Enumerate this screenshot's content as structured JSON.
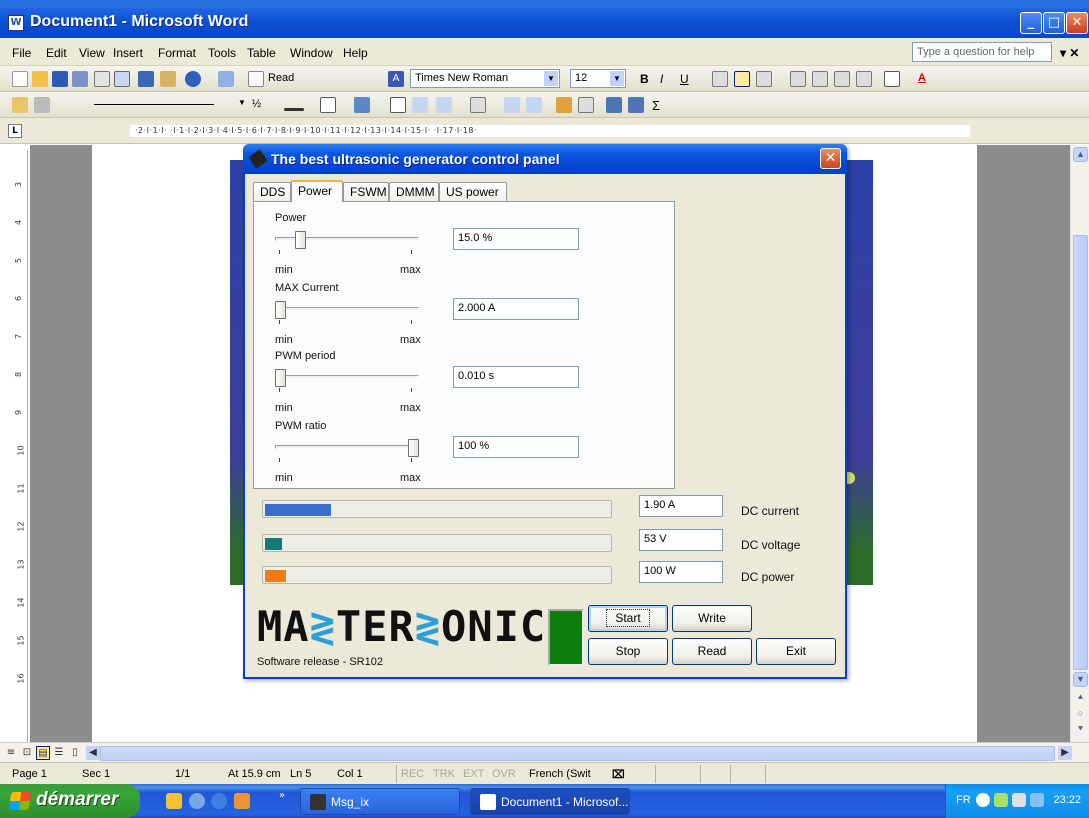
{
  "word": {
    "title": "Document1 - Microsoft Word",
    "menu": [
      "File",
      "Edit",
      "View",
      "Insert",
      "Format",
      "Tools",
      "Table",
      "Window",
      "Help"
    ],
    "help_placeholder": "Type a question for help",
    "read_label": "Read",
    "font_name": "Times New Roman",
    "font_size": "12",
    "line_width": "½",
    "ruler_marks": "·2·I·1·I·  ·I·1·I·2·I·3·I·4·I·5·I·6·I·7·I·8·I·9·I·10·I·11·I·12·I·13·I·14·I·15·I·  ·I·17·I·18·",
    "left_ruler_marks": [
      "3",
      "4",
      "5",
      "6",
      "7",
      "8",
      "9",
      "10",
      "11",
      "12",
      "13",
      "14",
      "15",
      "16"
    ]
  },
  "status": {
    "page": "Page 1",
    "sec": "Sec 1",
    "pages": "1/1",
    "at": "At 15.9 cm",
    "ln": "Ln 5",
    "col": "Col 1",
    "rec": "REC",
    "trk": "TRK",
    "ext": "EXT",
    "ovr": "OVR",
    "lang": "French (Swit"
  },
  "taskbar": {
    "start": "démarrer",
    "tasks": [
      "Msg_ix",
      "Document1 - Microsof..."
    ],
    "lang": "FR",
    "clock": "23:22"
  },
  "dialog": {
    "title": "The best ultrasonic generator control panel",
    "tabs": [
      "DDS",
      "Power",
      "FSWM",
      "DMMM",
      "US power"
    ],
    "active_tab": "Power",
    "sliders": [
      {
        "label": "Power",
        "value": "15.0 %",
        "min": "min",
        "max": "max",
        "level": 0.15
      },
      {
        "label": "MAX Current",
        "value": "2.000 A",
        "min": "min",
        "max": "max",
        "level": 0.0
      },
      {
        "label": "PWM period",
        "value": "0.010 s",
        "min": "min",
        "max": "max",
        "level": 0.0
      },
      {
        "label": "PWM ratio",
        "value": "100 %",
        "min": "min",
        "max": "max",
        "level": 1.0
      }
    ],
    "meters": [
      {
        "label": "DC current",
        "value": "1.90 A",
        "level": 0.19,
        "color": "#3a6fcf"
      },
      {
        "label": "DC voltage",
        "value": "53 V",
        "level": 0.05,
        "color": "#0f7c75"
      },
      {
        "label": "DC power",
        "value": "100 W",
        "level": 0.06,
        "color": "#f27a10"
      }
    ],
    "logo": {
      "a": "MA",
      "s1": "≷",
      "b": "TER",
      "s2": "≷",
      "c": "ONIC"
    },
    "release": "Software release - SR102",
    "buttons": {
      "start": "Start",
      "write": "Write",
      "stop": "Stop",
      "read": "Read",
      "exit": "Exit"
    },
    "indicator_color": "#0b7e0b"
  }
}
